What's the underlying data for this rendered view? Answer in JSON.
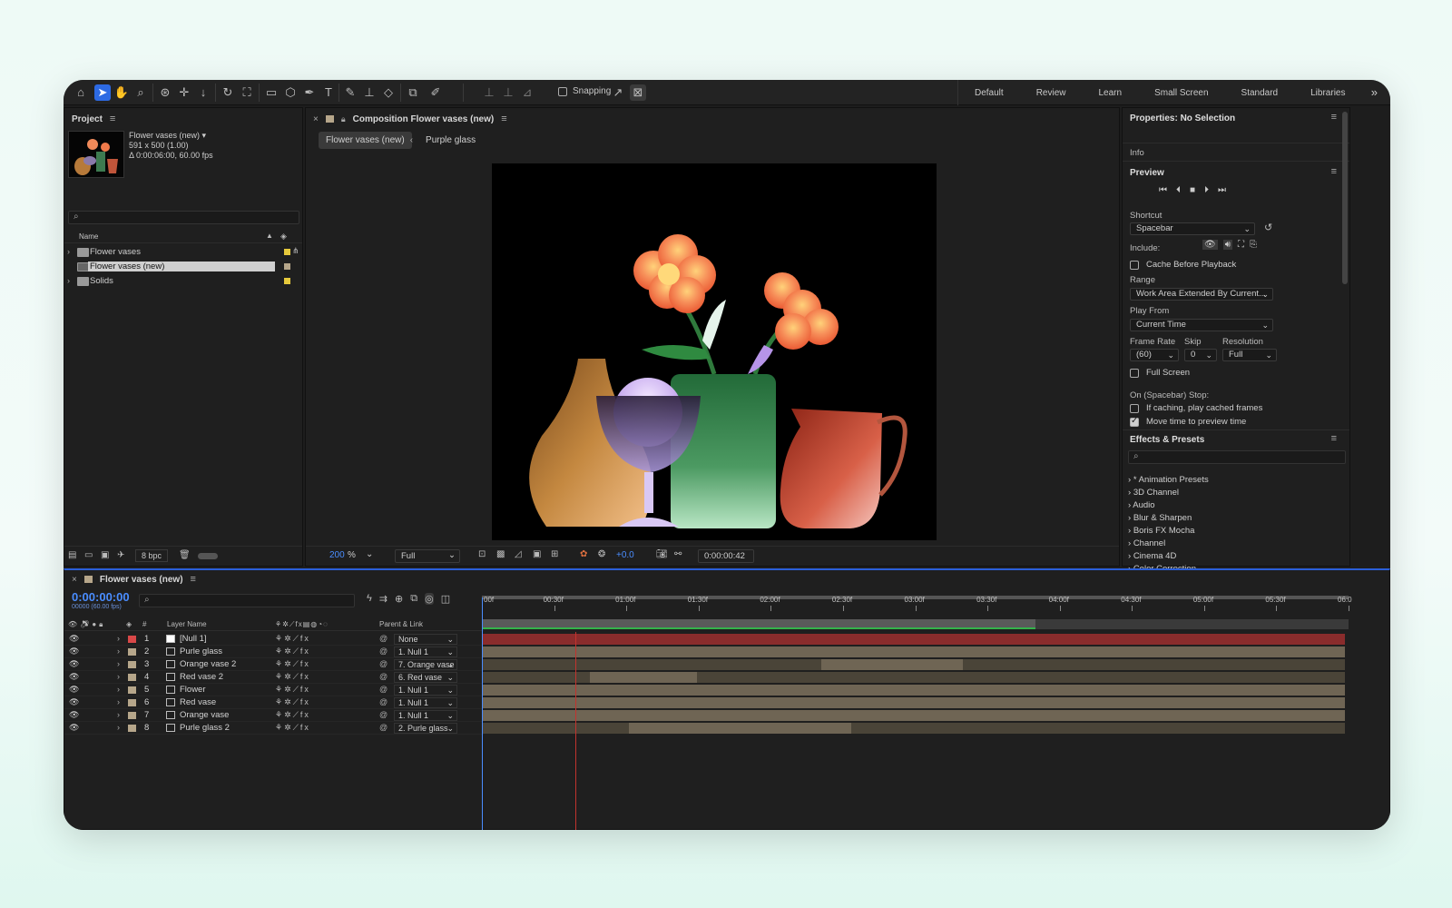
{
  "toolbar": {
    "snapping_label": "Snapping",
    "workspaces": [
      "Default",
      "Review",
      "Learn",
      "Small Screen",
      "Standard",
      "Libraries"
    ]
  },
  "project": {
    "title": "Project",
    "comp_name": "Flower vases (new) ▾",
    "comp_size": "591 x 500 (1.00)",
    "comp_duration": "Δ 0:00:06:00, 60.00 fps",
    "col_name": "Name",
    "items": [
      {
        "label": "Flower vases",
        "type": "folder",
        "color": "#e6c93c",
        "selected": false
      },
      {
        "label": "Flower vases (new)",
        "type": "comp",
        "color": "#b6a68a",
        "selected": true
      },
      {
        "label": "Solids",
        "type": "folder",
        "color": "#e6c93c",
        "selected": false
      }
    ],
    "bpc": "8 bpc"
  },
  "composition": {
    "tab_title": "Composition Flower vases (new)",
    "crumbs": [
      "Flower vases (new)",
      "Purple glass"
    ],
    "zoom": "200",
    "zoom_unit": "%",
    "resolution": "Full",
    "exposure": "+0.0",
    "time": "0:00:00:42"
  },
  "properties": {
    "title": "Properties: No Selection",
    "info": "Info",
    "preview_title": "Preview",
    "shortcut_label": "Shortcut",
    "shortcut_value": "Spacebar",
    "include_label": "Include:",
    "cache_label": "Cache Before Playback",
    "range_label": "Range",
    "range_value": "Work Area Extended By Current...",
    "playfrom_label": "Play From",
    "playfrom_value": "Current Time",
    "framerate_label": "Frame Rate",
    "skip_label": "Skip",
    "resolution_label": "Resolution",
    "framerate_value": "(60)",
    "skip_value": "0",
    "resolution_value": "Full",
    "fullscreen_label": "Full Screen",
    "stop_label": "On (Spacebar) Stop:",
    "cached_label": "If caching, play cached frames",
    "movetime_label": "Move time to preview time",
    "effects_title": "Effects & Presets",
    "effects": [
      "* Animation Presets",
      "3D Channel",
      "Audio",
      "Blur & Sharpen",
      "Boris FX Mocha",
      "Channel",
      "Cinema 4D",
      "Color Correction"
    ]
  },
  "timeline": {
    "tab_title": "Flower vases (new)",
    "timecode": "0:00:00:00",
    "timecode_sub": "00000 (60.00 fps)",
    "col_num": "#",
    "col_layer": "Layer Name",
    "col_parent": "Parent & Link",
    "ruler": [
      "00f",
      "00:30f",
      "01:00f",
      "01:30f",
      "02:00f",
      "02:30f",
      "03:00f",
      "03:30f",
      "04:00f",
      "04:30f",
      "05:00f",
      "05:30f",
      "06:0"
    ],
    "layers": [
      {
        "num": "1",
        "name": "[Null 1]",
        "parent": "None",
        "color": "#d94848",
        "icon_fill": "#ffffff",
        "bar_color": "#8a2c2c",
        "bar_start": 0,
        "bar_end": 6.0
      },
      {
        "num": "2",
        "name": "Purle glass",
        "parent": "1. Null 1",
        "color": "#b6a68a",
        "icon_fill": "",
        "bar_color": "#6f6554",
        "bar_start": 0,
        "bar_end": 6.0
      },
      {
        "num": "3",
        "name": "Orange vase 2",
        "parent": "7. Orange vase",
        "color": "#b6a68a",
        "icon_fill": "",
        "bar_color": "#4a4438",
        "bar_start": 0,
        "bar_end": 6.0,
        "hl_start": 2.35,
        "hl_end": 3.33
      },
      {
        "num": "4",
        "name": "Red vase 2",
        "parent": "6. Red vase",
        "color": "#b6a68a",
        "icon_fill": "",
        "bar_color": "#4a4438",
        "bar_start": 0,
        "bar_end": 6.0,
        "hl_start": 0.75,
        "hl_end": 1.49
      },
      {
        "num": "5",
        "name": "Flower",
        "parent": "1. Null 1",
        "color": "#b6a68a",
        "icon_fill": "",
        "bar_color": "#6f6554",
        "bar_start": 0,
        "bar_end": 6.0
      },
      {
        "num": "6",
        "name": "Red vase",
        "parent": "1. Null 1",
        "color": "#b6a68a",
        "icon_fill": "",
        "bar_color": "#6f6554",
        "bar_start": 0,
        "bar_end": 6.0
      },
      {
        "num": "7",
        "name": "Orange vase",
        "parent": "1. Null 1",
        "color": "#b6a68a",
        "icon_fill": "",
        "bar_color": "#6f6554",
        "bar_start": 0,
        "bar_end": 6.0
      },
      {
        "num": "8",
        "name": "Purle glass 2",
        "parent": "2. Purle glass",
        "color": "#b6a68a",
        "icon_fill": "",
        "bar_color": "#4a4438",
        "bar_start": 0,
        "bar_end": 6.0,
        "hl_start": 1.02,
        "hl_end": 2.56
      }
    ],
    "work_area_end": 3.83,
    "playhead": 0.0,
    "marker": 0.65
  },
  "colors": {
    "accent": "#2d6ae3",
    "timecode": "#4a8dff"
  }
}
